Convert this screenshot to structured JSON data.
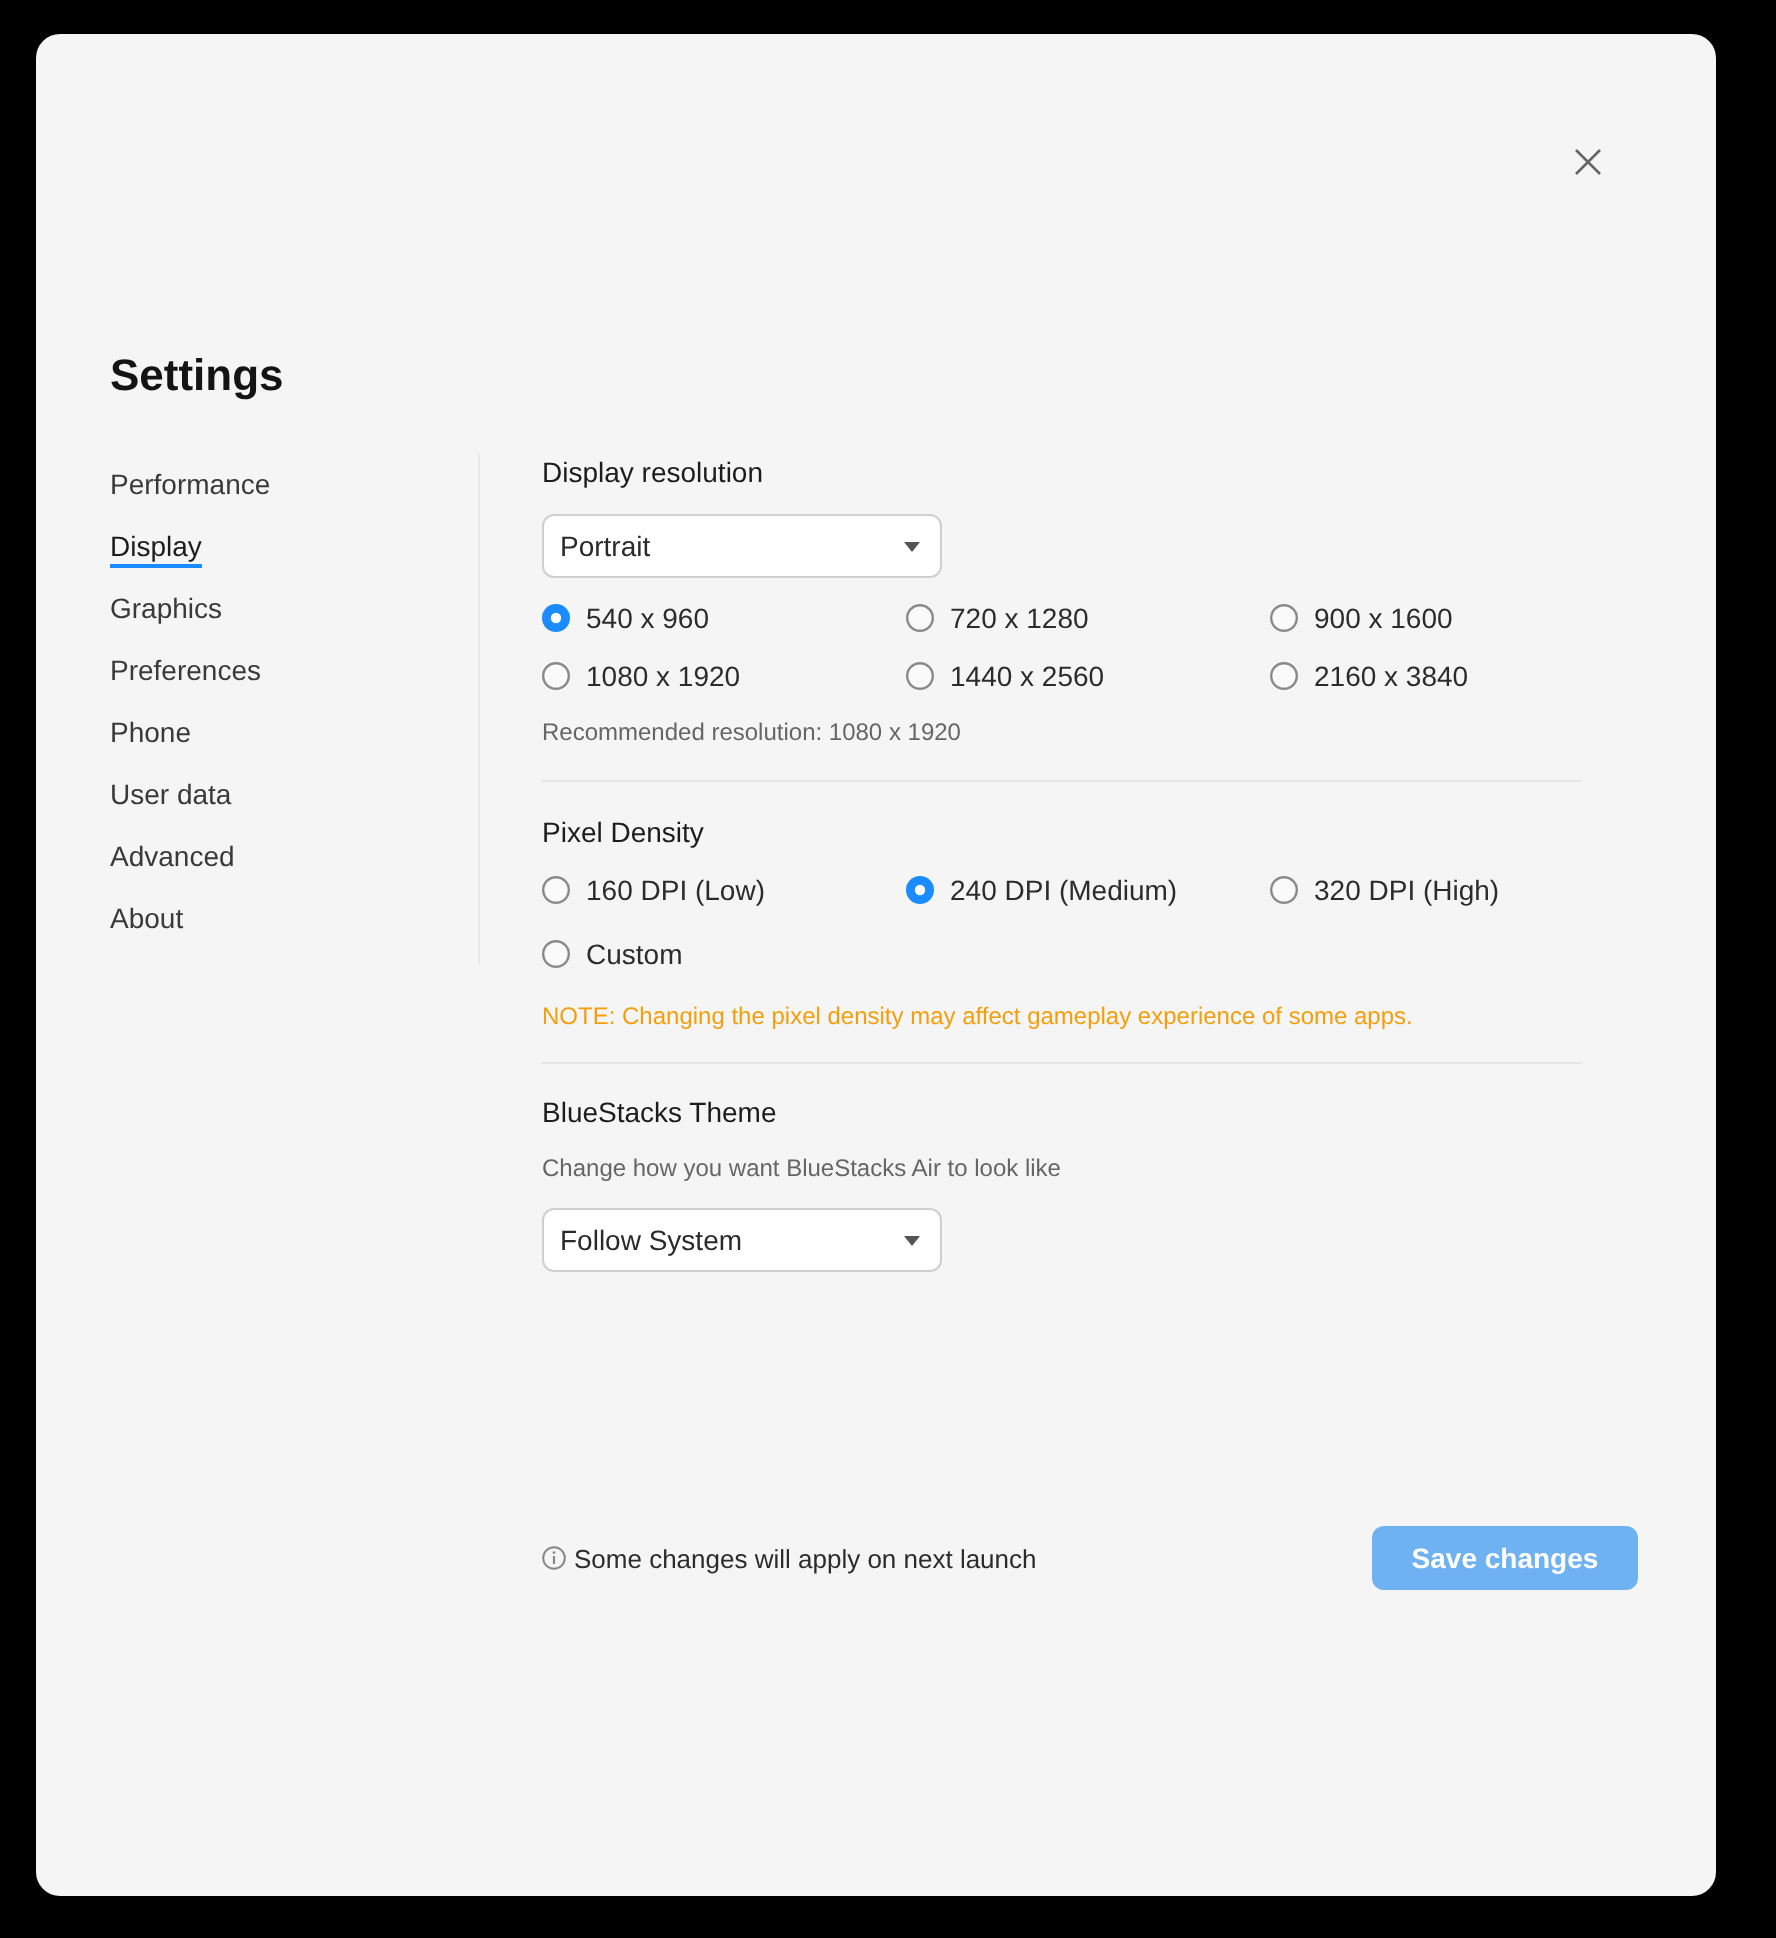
{
  "title": "Settings",
  "sidebar": {
    "items": [
      {
        "label": "Performance",
        "selected": false
      },
      {
        "label": "Display",
        "selected": true
      },
      {
        "label": "Graphics",
        "selected": false
      },
      {
        "label": "Preferences",
        "selected": false
      },
      {
        "label": "Phone",
        "selected": false
      },
      {
        "label": "User data",
        "selected": false
      },
      {
        "label": "Advanced",
        "selected": false
      },
      {
        "label": "About",
        "selected": false
      }
    ]
  },
  "display_resolution": {
    "heading": "Display resolution",
    "dropdown": {
      "value": "Portrait"
    },
    "options": [
      {
        "label": "540 x 960",
        "selected": true
      },
      {
        "label": "720 x 1280",
        "selected": false
      },
      {
        "label": "900 x 1600",
        "selected": false
      },
      {
        "label": "1080 x 1920",
        "selected": false
      },
      {
        "label": "1440 x 2560",
        "selected": false
      },
      {
        "label": "2160 x 3840",
        "selected": false
      }
    ],
    "hint": "Recommended resolution: 1080 x 1920"
  },
  "pixel_density": {
    "heading": "Pixel Density",
    "options": [
      {
        "label": "160 DPI (Low)",
        "selected": false
      },
      {
        "label": "240 DPI (Medium)",
        "selected": true
      },
      {
        "label": "320 DPI (High)",
        "selected": false
      },
      {
        "label": "Custom",
        "selected": false
      }
    ],
    "note": "NOTE: Changing the pixel density may affect gameplay experience of some apps."
  },
  "theme": {
    "heading": "BlueStacks Theme",
    "description": "Change how you want BlueStacks Air to look like",
    "dropdown": {
      "value": "Follow System"
    }
  },
  "footer": {
    "info": "Some changes will apply on next launch",
    "save_button": {
      "label": "Save changes",
      "disabled": true
    }
  }
}
